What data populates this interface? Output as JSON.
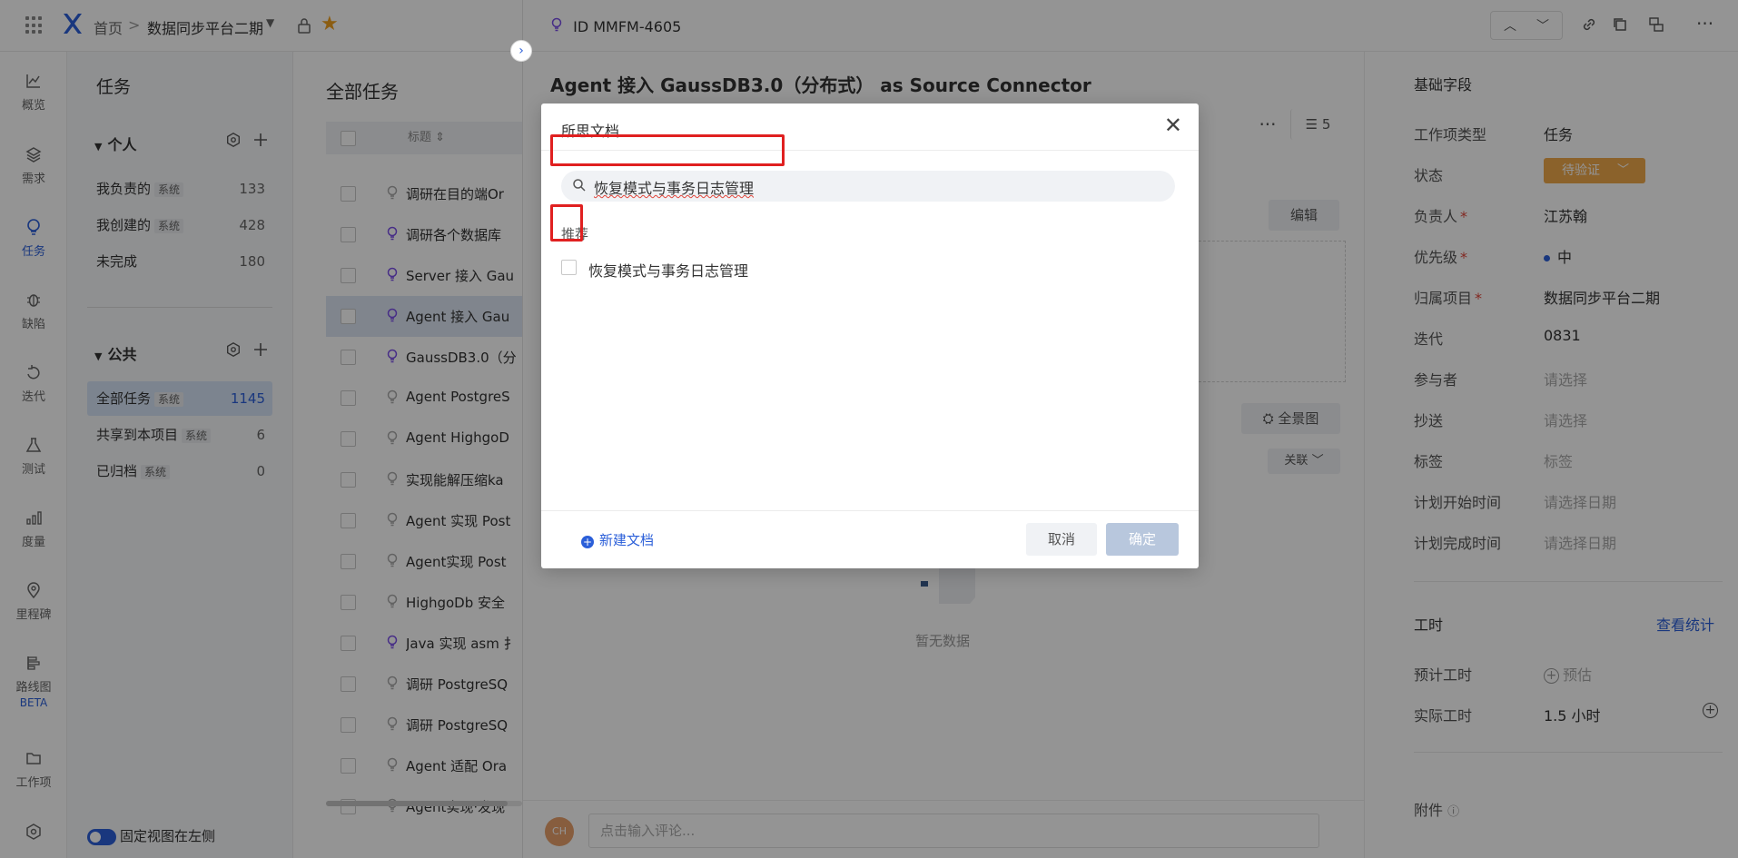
{
  "topbar": {
    "home": "首页",
    "separator": ">",
    "project": "数据同步平台二期"
  },
  "rail": [
    {
      "label": "概览",
      "icon": "chart-line-icon"
    },
    {
      "label": "需求",
      "icon": "layers-icon"
    },
    {
      "label": "任务",
      "icon": "bulb-icon"
    },
    {
      "label": "缺陷",
      "icon": "bug-icon"
    },
    {
      "label": "迭代",
      "icon": "cycle-icon"
    },
    {
      "label": "测试",
      "icon": "flask-icon"
    },
    {
      "label": "度量",
      "icon": "bar-chart-icon"
    },
    {
      "label": "里程碑",
      "icon": "location-icon"
    },
    {
      "label": "路线图",
      "icon": "roadmap-icon"
    },
    {
      "label": "工作项",
      "icon": "folder-icon"
    }
  ],
  "rail_beta": "BETA",
  "nav": {
    "title": "任务",
    "personal": "个人",
    "public": "公共",
    "items": [
      {
        "label": "我负责的",
        "tag": "系统",
        "count": "133"
      },
      {
        "label": "我创建的",
        "tag": "系统",
        "count": "428"
      },
      {
        "label": "未完成",
        "tag": "",
        "count": "180"
      },
      {
        "label": "全部任务",
        "tag": "系统",
        "count": "1145"
      },
      {
        "label": "共享到本项目",
        "tag": "系统",
        "count": "6"
      },
      {
        "label": "已归档",
        "tag": "系统",
        "count": "0"
      }
    ],
    "pin_label": "固定视图在左侧"
  },
  "tasklist": {
    "title": "全部任务",
    "header_title": "标题",
    "rows": [
      "调研在目的端Or",
      "调研各个数据库",
      "Server 接入 Gau",
      "Agent 接入 Gau",
      "GaussDB3.0（分",
      "Agent PostgreS",
      "Agent HighgoD",
      "实现能解压缩ka",
      "Agent 实现 Post",
      "Agent实现 Post",
      "HighgoDb 安全",
      "Java 实现 asm 扌",
      "调研 PostgreSQ",
      "调研 PostgreSQ",
      "Agent 适配 Ora",
      "Agent实现·发现"
    ]
  },
  "drawer": {
    "id": "ID MMFM-4605",
    "title": "Agent  接入 GaussDB3.0（分布式） as Source  Connector",
    "subtask_count": "5",
    "edit_label": "编辑",
    "overview_label": "全景图",
    "relation_label": "关联",
    "empty_text": "暂无数据",
    "comment_avatar": "CH",
    "comment_placeholder": "点击输入评论..."
  },
  "props": {
    "section": "基础字段",
    "fields": [
      {
        "label": "工作项类型",
        "required": false,
        "value": "任务",
        "placeholder": false
      },
      {
        "label": "状态",
        "required": false,
        "value": "",
        "placeholder": false
      },
      {
        "label": "负责人",
        "required": true,
        "value": "江苏翰",
        "placeholder": false
      },
      {
        "label": "优先级",
        "required": true,
        "value": "中",
        "placeholder": false
      },
      {
        "label": "归属项目",
        "required": true,
        "value": "数据同步平台二期",
        "placeholder": false
      },
      {
        "label": "迭代",
        "required": false,
        "value": "0831",
        "placeholder": false
      },
      {
        "label": "参与者",
        "required": false,
        "value": "请选择",
        "placeholder": true
      },
      {
        "label": "抄送",
        "required": false,
        "value": "请选择",
        "placeholder": true
      },
      {
        "label": "标签",
        "required": false,
        "value": "标签",
        "placeholder": true
      },
      {
        "label": "计划开始时间",
        "required": false,
        "value": "请选择日期",
        "placeholder": true
      },
      {
        "label": "计划完成时间",
        "required": false,
        "value": "请选择日期",
        "placeholder": true
      }
    ],
    "status_value": "待验证",
    "required_mark": "*",
    "worktime_title": "工时",
    "worktime_link": "查看统计",
    "estimated_label": "预计工时",
    "estimated_value": "预估",
    "actual_label": "实际工时",
    "actual_value": "1.5  小时",
    "attachment_label": "附件"
  },
  "modal": {
    "title": "所思文档",
    "search_value": "恢复模式与事务日志管理",
    "section": "推荐",
    "item_label": "恢复模式与事务日志管理",
    "new_doc": "新建文档",
    "cancel": "取消",
    "confirm": "确定"
  },
  "colors": {
    "accent": "#2b5fd9",
    "status": "#f0a94a",
    "highlight": "#e02020",
    "task_icon": "#7a4ee8"
  }
}
